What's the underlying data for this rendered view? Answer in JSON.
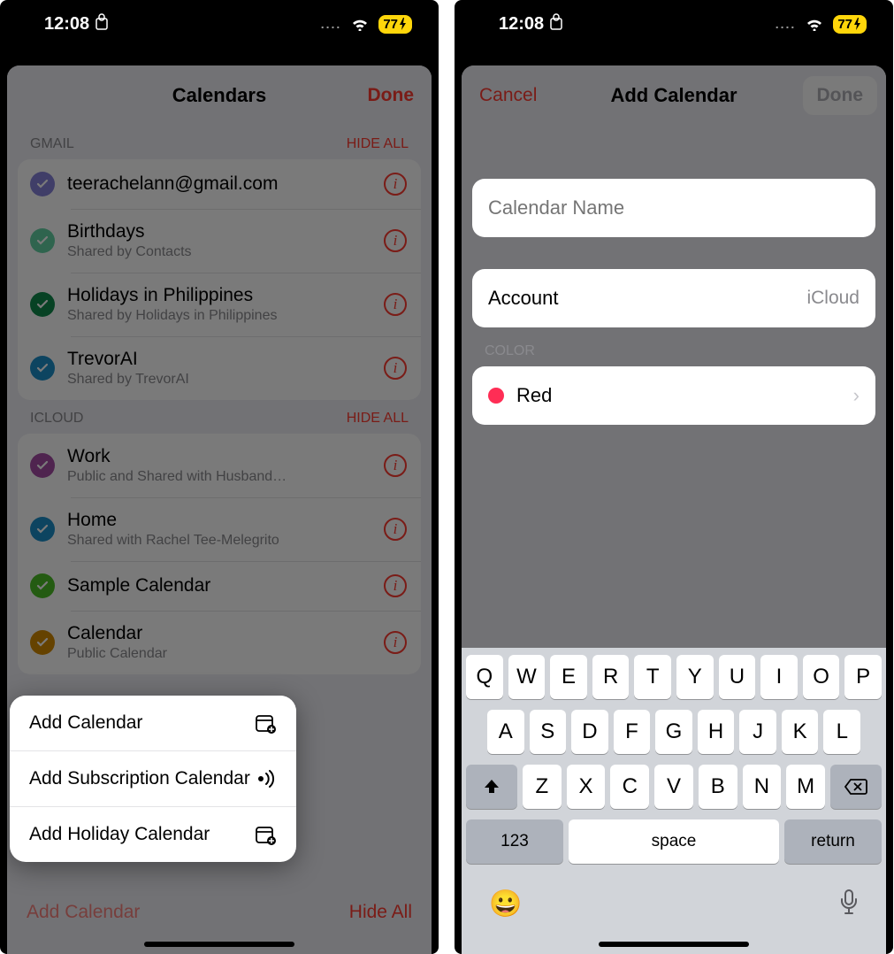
{
  "status": {
    "time": "12:08",
    "battery": "77",
    "dots": "...."
  },
  "left": {
    "nav": {
      "title": "Calendars",
      "done": "Done"
    },
    "sections": [
      {
        "header": "GMAIL",
        "hide": "HIDE ALL",
        "rows": [
          {
            "name": "teerachelann@gmail.com",
            "sub": "",
            "color": "#8782d9"
          },
          {
            "name": "Birthdays",
            "sub": "Shared by Contacts",
            "color": "#63d2a4"
          },
          {
            "name": "Holidays in Philippines",
            "sub": "Shared by Holidays in Philippines",
            "color": "#0f8a4b"
          },
          {
            "name": "TrevorAI",
            "sub": "Shared by TrevorAI",
            "color": "#1c8fc9"
          }
        ]
      },
      {
        "header": "ICLOUD",
        "hide": "HIDE ALL",
        "rows": [
          {
            "name": "Work",
            "sub": "Public and Shared with Husband…",
            "color": "#a64ca6"
          },
          {
            "name": "Home",
            "sub": "Shared with Rachel Tee-Melegrito",
            "color": "#1c8fc9"
          },
          {
            "name": "Sample Calendar",
            "sub": "",
            "color": "#4cbf26"
          },
          {
            "name": "Calendar",
            "sub": "Public Calendar",
            "color": "#d48a00"
          }
        ]
      }
    ],
    "popup": {
      "items": [
        {
          "label": "Add Calendar",
          "icon": "calendar-plus"
        },
        {
          "label": "Add Subscription Calendar",
          "icon": "broadcast"
        },
        {
          "label": "Add Holiday Calendar",
          "icon": "calendar-plus"
        }
      ]
    },
    "bottom": {
      "add": "Add Calendar",
      "hide": "Hide All"
    }
  },
  "right": {
    "nav": {
      "cancel": "Cancel",
      "title": "Add Calendar",
      "done": "Done"
    },
    "form": {
      "name_placeholder": "Calendar Name",
      "account_label": "Account",
      "account_value": "iCloud",
      "color_header": "COLOR",
      "color_label": "Red",
      "color_hex": "#ff2d55"
    },
    "keyboard": {
      "row1": [
        "Q",
        "W",
        "E",
        "R",
        "T",
        "Y",
        "U",
        "I",
        "O",
        "P"
      ],
      "row2": [
        "A",
        "S",
        "D",
        "F",
        "G",
        "H",
        "J",
        "K",
        "L"
      ],
      "row3": [
        "Z",
        "X",
        "C",
        "V",
        "B",
        "N",
        "M"
      ],
      "num": "123",
      "space": "space",
      "ret": "return"
    }
  }
}
